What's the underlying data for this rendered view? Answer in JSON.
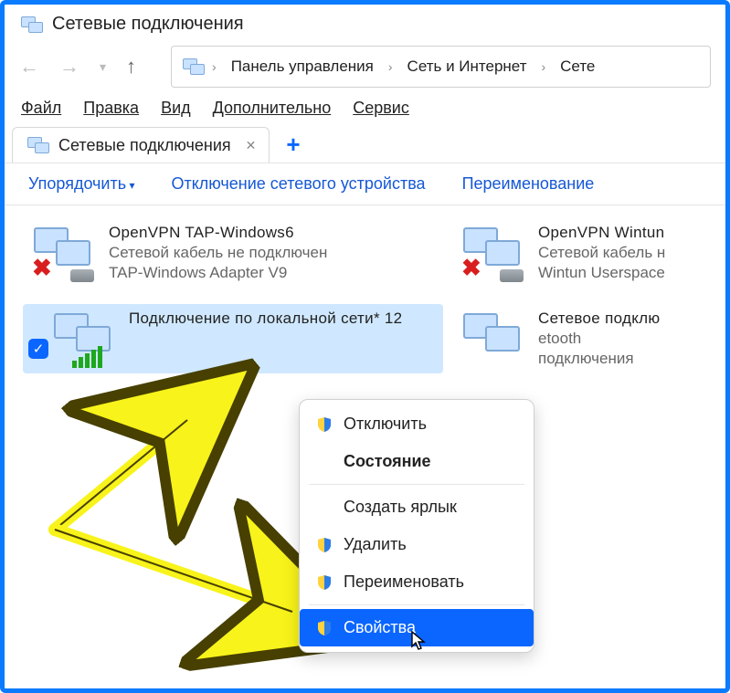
{
  "window": {
    "title": "Сетевые подключения"
  },
  "breadcrumb": {
    "items": [
      "Панель управления",
      "Сеть и Интернет",
      "Сете"
    ]
  },
  "menubar": {
    "file": "Файл",
    "edit": "Правка",
    "view": "Вид",
    "extra": "Дополнительно",
    "service": "Сервис"
  },
  "tab": {
    "label": "Сетевые подключения"
  },
  "toolbar": {
    "organize": "Упорядочить",
    "disable_device": "Отключение сетевого устройства",
    "rename": "Переименование"
  },
  "connections": [
    {
      "name": "OpenVPN TAP-Windows6",
      "status": "Сетевой кабель не подключен",
      "device": "TAP-Windows Adapter V9",
      "state": "disconnected"
    },
    {
      "name": "OpenVPN Wintun",
      "status": "Сетевой кабель н",
      "device": "Wintun Userspace",
      "state": "disconnected"
    },
    {
      "name": "Подключение по локальной сети* 12",
      "status": "",
      "device": "",
      "state": "connected-wifi",
      "selected": true
    },
    {
      "name": "Сетевое подклю",
      "status": "etooth",
      "device": "подключения",
      "state": "normal"
    }
  ],
  "context_menu": {
    "disable": "Отключить",
    "status": "Состояние",
    "create_shortcut": "Создать ярлык",
    "delete": "Удалить",
    "rename": "Переименовать",
    "properties": "Свойства"
  }
}
